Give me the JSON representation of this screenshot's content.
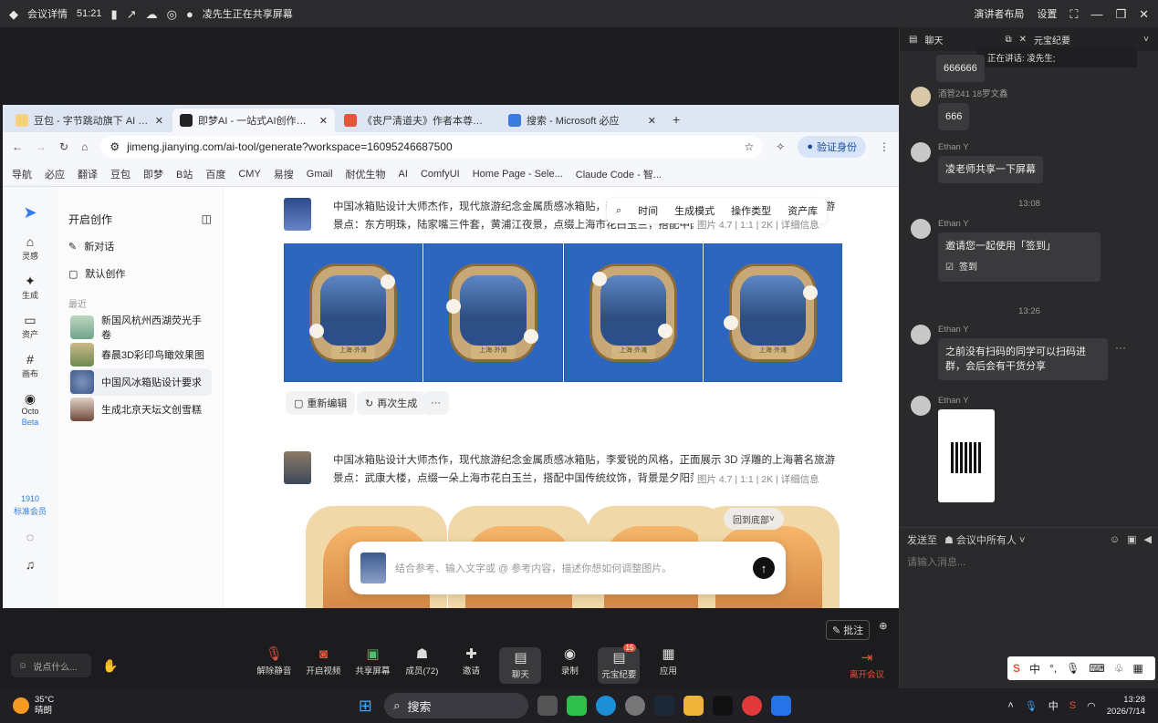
{
  "topbar": {
    "meeting_details": "会议详情",
    "duration": "51:21",
    "sharing": "凌先生正在共享屏幕",
    "layout": "演讲者布局",
    "settings": "设置"
  },
  "browser": {
    "tabs": [
      {
        "label": "豆包 - 字节跳动旗下 AI 智能助手"
      },
      {
        "label": "即梦AI - 一站式AI创作平台"
      },
      {
        "label": "《丧尸清道夫》作者本尊公开招"
      },
      {
        "label": "搜索 - Microsoft 必应"
      }
    ],
    "url": "jimeng.jianying.com/ai-tool/generate?workspace=16095246687500",
    "verify": "验证身份",
    "bookmarks": [
      "导航",
      "必应",
      "翻译",
      "豆包",
      "即梦",
      "B站",
      "百度",
      "CMY",
      "易搜",
      "Gmail",
      "耐优生物",
      "AI",
      "ComfyUI",
      "Home Page - Sele...",
      "Claude Code - 智..."
    ]
  },
  "app": {
    "rail": [
      {
        "label": "灵感"
      },
      {
        "label": "生成"
      },
      {
        "label": "资产"
      },
      {
        "label": "画布"
      },
      {
        "label": "Octo"
      }
    ],
    "beta": "Beta",
    "member": {
      "count": "1910",
      "label": "标准会员"
    },
    "menu_title": "开启创作",
    "new_chat": "新对话",
    "default_create": "默认创作",
    "recent_label": "最近",
    "recent": [
      {
        "label": "新国风杭州西湖荧光手卷"
      },
      {
        "label": "春晨3D彩印鸟瞰效果图"
      },
      {
        "label": "中国风冰箱贴设计要求"
      },
      {
        "label": "生成北京天坛文创雪糕"
      }
    ],
    "toolbar": {
      "time": "时间",
      "mode": "生成模式",
      "op": "操作类型",
      "assets": "资产库"
    },
    "prompt1": "中国冰箱贴设计大师杰作，现代旅游纪念金属质感冰箱贴，李爱锐的风格，正面展示 3D 浮雕的上海著名旅游景点：东方明珠，陆家嘴三件套，黄浦江夜景，点缀上海市花白玉兰，搭配中国传统纹饰",
    "meta1": "图片 4.7 | 1:1 | 2K | 详细信息",
    "tag": "上海·外滩",
    "reedit": "重新编辑",
    "regen": "再次生成",
    "more": "···",
    "prompt2": "中国冰箱贴设计大师杰作，现代旅游纪念金属质感冰箱贴，李爱锐的风格，正面展示 3D 浮雕的上海著名旅游景点：武康大楼，点缀一朵上海市花白玉兰，搭配中国传统纹饰，背景是夕阳落下的余晖",
    "meta2": "图片 4.7 | 1:1 | 2K | 详细信息",
    "back_bottom": "回到底部",
    "input_placeholder": "结合参考、输入文字或 @ 参考内容，描述你想如何调整图片。"
  },
  "chat": {
    "tab_chat": "聊天",
    "tab_yuanbao": "元宝纪要",
    "speaking": "正在讲话: 凌先生;",
    "messages": [
      {
        "name": "",
        "text": "666666"
      },
      {
        "name": "酒管241 18罗文鑫",
        "text": "666"
      },
      {
        "name": "Ethan Y",
        "text": "凌老师共享一下屏幕"
      },
      {
        "name": "Ethan Y",
        "text": "邀请您一起使用「签到」",
        "action": "签到"
      },
      {
        "name": "Ethan Y",
        "text": "之前没有扫码的同学可以扫码进群，会后会有干货分享"
      },
      {
        "name": "Ethan Y",
        "text": ""
      }
    ],
    "times": [
      "13:08",
      "13:26"
    ],
    "send_to": "发送至",
    "audience": "会议中所有人",
    "input_placeholder": "请输入消息..."
  },
  "controls": {
    "say": "说点什么...",
    "items": [
      {
        "label": "解除静音"
      },
      {
        "label": "开启视频"
      },
      {
        "label": "共享屏幕"
      },
      {
        "label": "成员(72)"
      },
      {
        "label": "邀请"
      },
      {
        "label": "聊天"
      },
      {
        "label": "录制"
      },
      {
        "label": "元宝纪要"
      },
      {
        "label": "应用"
      }
    ],
    "yuanbao_badge": "15",
    "leave": "离开会议",
    "annotate": "批注"
  },
  "taskbar": {
    "temp": "35°C",
    "weather": "晴朗",
    "search": "搜索",
    "ime": "中",
    "time": "13:28",
    "date": "2026/7/14"
  }
}
